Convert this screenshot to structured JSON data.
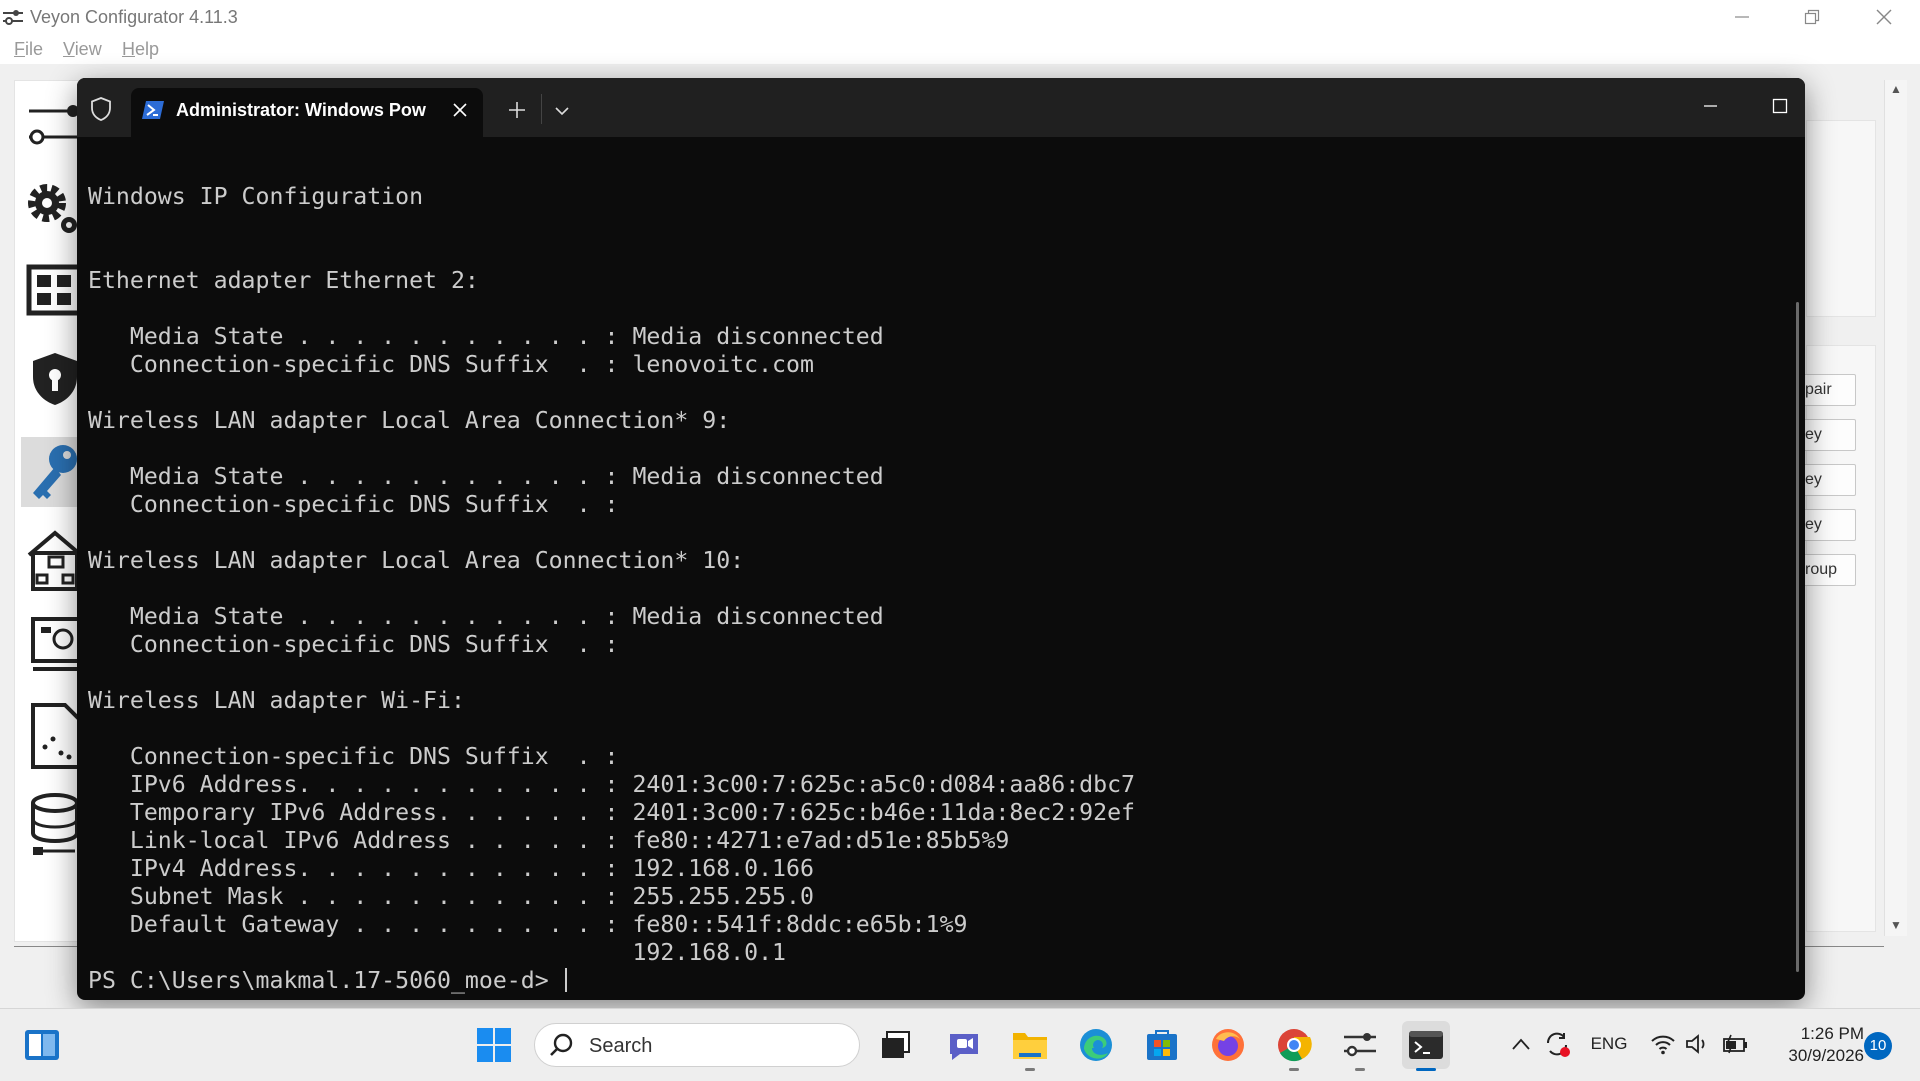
{
  "veyon": {
    "title": "Veyon Configurator 4.11.3",
    "menu": [
      "File",
      "View",
      "Help"
    ],
    "sidebar_items": [
      "general-settings",
      "computer-settings",
      "access-control",
      "authentication-keys",
      "locations-computers",
      "screenshots",
      "demo-server",
      "ldap"
    ],
    "buttons": [
      "pair",
      "ey",
      "ey",
      "ey",
      "roup"
    ]
  },
  "terminal": {
    "tab_title": "Administrator: Windows PowerShell",
    "lines": [
      "",
      "Windows IP Configuration",
      "",
      "",
      "Ethernet adapter Ethernet 2:",
      "",
      "   Media State . . . . . . . . . . . : Media disconnected",
      "   Connection-specific DNS Suffix  . : lenovoitc.com",
      "",
      "Wireless LAN adapter Local Area Connection* 9:",
      "",
      "   Media State . . . . . . . . . . . : Media disconnected",
      "   Connection-specific DNS Suffix  . :",
      "",
      "Wireless LAN adapter Local Area Connection* 10:",
      "",
      "   Media State . . . . . . . . . . . : Media disconnected",
      "   Connection-specific DNS Suffix  . :",
      "",
      "Wireless LAN adapter Wi-Fi:",
      "",
      "   Connection-specific DNS Suffix  . :",
      "   IPv6 Address. . . . . . . . . . . : 2401:3c00:7:625c:a5c0:d084:aa86:dbc7",
      "   Temporary IPv6 Address. . . . . . : 2401:3c00:7:625c:b46e:11da:8ec2:92ef",
      "   Link-local IPv6 Address . . . . . : fe80::4271:e7ad:d51e:85b5%9",
      "   IPv4 Address. . . . . . . . . . . : 192.168.0.166",
      "   Subnet Mask . . . . . . . . . . . : 255.255.255.0",
      "   Default Gateway . . . . . . . . . : fe80::541f:8ddc:e65b:1%9",
      "                                       192.168.0.1"
    ],
    "prompt": "PS C:\\Users\\makmal.17-5060_moe-d> "
  },
  "taskbar": {
    "search_placeholder": "Search",
    "language": "ENG",
    "time": "1:26 PM",
    "date": "30/9/2026",
    "notification_count": "10",
    "accent": "#0067c0"
  }
}
